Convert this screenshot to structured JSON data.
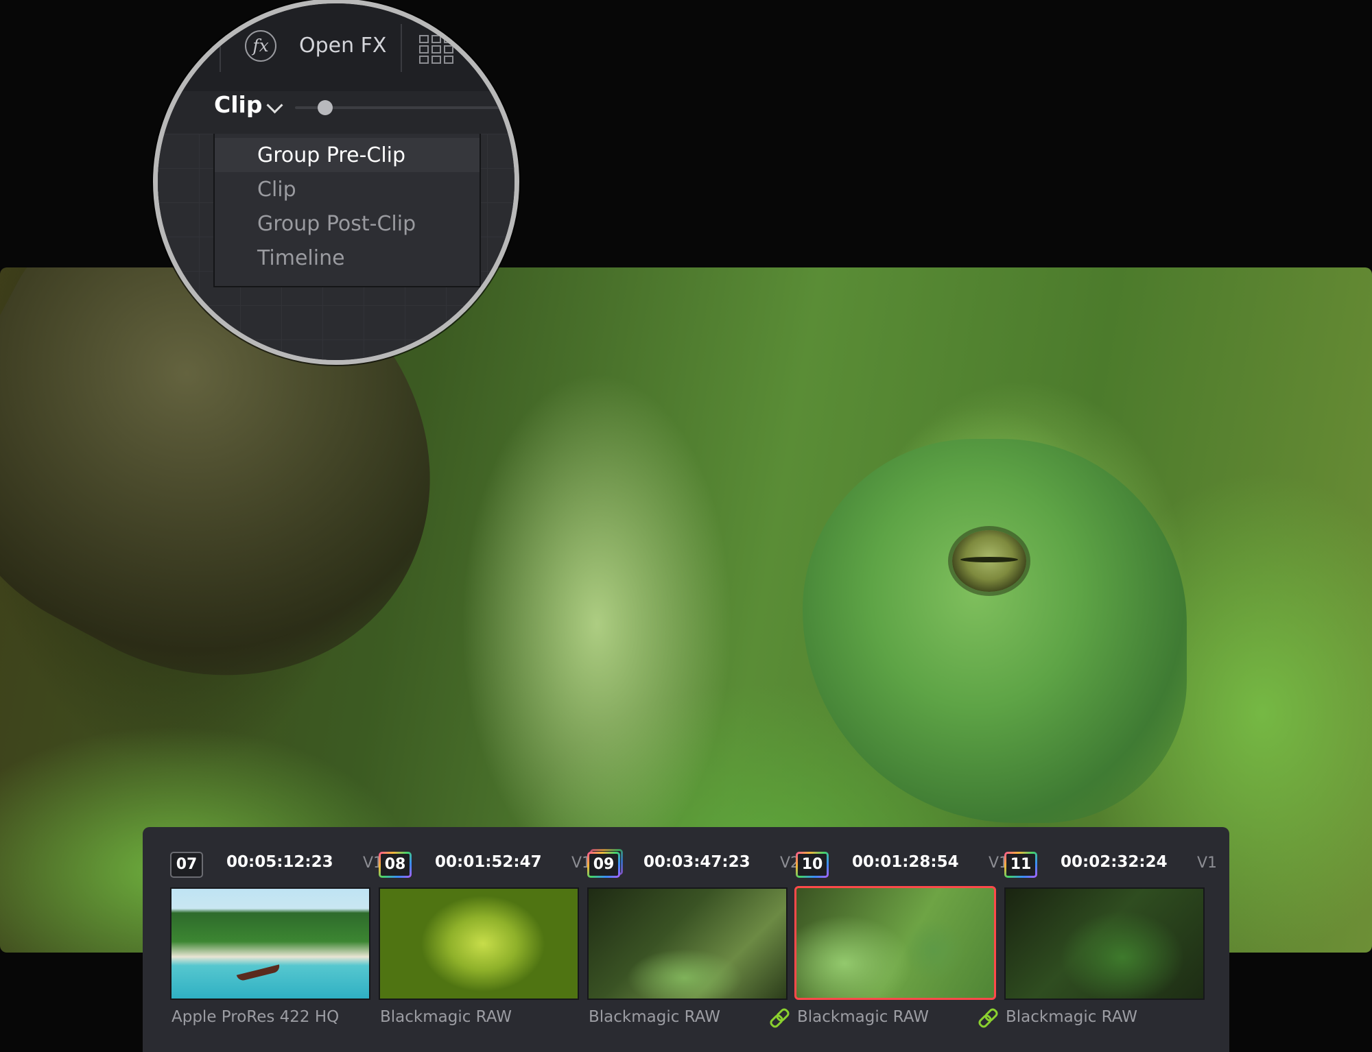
{
  "openfx": {
    "icon": "fx-icon",
    "label": "Open FX"
  },
  "mode_selector": {
    "selected": "Clip",
    "icon": "chevron-down-icon"
  },
  "dropdown": {
    "items": [
      {
        "label": "Group Pre-Clip",
        "highlighted": true
      },
      {
        "label": "Clip"
      },
      {
        "label": "Group Post-Clip"
      },
      {
        "label": "Timeline"
      }
    ]
  },
  "clips": [
    {
      "number": "07",
      "timecode": "00:05:12:23",
      "track": "V1",
      "codec": "Apple ProRes 422 HQ",
      "linked": false,
      "selected": false
    },
    {
      "number": "08",
      "timecode": "00:01:52:47",
      "track": "V1",
      "codec": "Blackmagic RAW",
      "linked": false,
      "selected": false
    },
    {
      "number": "09",
      "timecode": "00:03:47:23",
      "track": "V2",
      "codec": "Blackmagic RAW",
      "linked": true,
      "selected": false
    },
    {
      "number": "10",
      "timecode": "00:01:28:54",
      "track": "V1",
      "codec": "Blackmagic RAW",
      "linked": true,
      "selected": true
    },
    {
      "number": "11",
      "timecode": "00:02:32:24",
      "track": "V1",
      "codec": "Blackmagic RAW",
      "linked": false,
      "selected": false
    }
  ],
  "colors": {
    "selection": "#ff4a4a",
    "link": "#8bd12f",
    "panel": "#2a2b31",
    "background": "#070707"
  }
}
